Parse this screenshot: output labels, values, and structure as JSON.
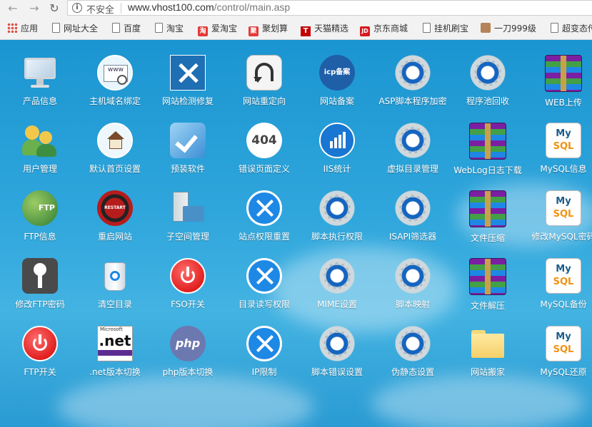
{
  "browser": {
    "address": {
      "insecure_label": "不安全",
      "url_host": "www.vhost100.com",
      "url_path": "/control/main.asp"
    },
    "bookmarks": [
      "应用",
      "网址大全",
      "百度",
      "淘宝",
      "爱淘宝",
      "聚划算",
      "天猫精选",
      "京东商城",
      "挂机刷宝",
      "一刀999级",
      "超变态传"
    ]
  },
  "desktop": {
    "items": [
      {
        "label": "产品信息",
        "icon": "monitor-icon"
      },
      {
        "label": "主机域名绑定",
        "icon": "www-globe-icon"
      },
      {
        "label": "网站检测修复",
        "icon": "tools-icon"
      },
      {
        "label": "网站重定向",
        "icon": "redirect-arrow-icon"
      },
      {
        "label": "网站备案",
        "icon": "icp-badge-icon"
      },
      {
        "label": "ASP脚本程序加密",
        "icon": "gear-icon"
      },
      {
        "label": "程序池回收",
        "icon": "gear-icon"
      },
      {
        "label": "WEB上传",
        "icon": "winrar-icon"
      },
      {
        "label": "用户管理",
        "icon": "users-icon"
      },
      {
        "label": "默认首页设置",
        "icon": "home-icon"
      },
      {
        "label": "预装软件",
        "icon": "checkmark-icon"
      },
      {
        "label": "错误页面定义",
        "icon": "404-icon"
      },
      {
        "label": "IIS统计",
        "icon": "bar-chart-icon"
      },
      {
        "label": "虚拟目录管理",
        "icon": "gear-icon"
      },
      {
        "label": "WebLog日志下载",
        "icon": "winrar-icon"
      },
      {
        "label": "MySQL信息",
        "icon": "mysql-icon"
      },
      {
        "label": "FTP信息",
        "icon": "ftp-globe-icon"
      },
      {
        "label": "重启网站",
        "icon": "restart-icon"
      },
      {
        "label": "子空间管理",
        "icon": "server-folder-icon"
      },
      {
        "label": "站点权限重置",
        "icon": "hammer-icon"
      },
      {
        "label": "脚本执行权限",
        "icon": "gear-icon"
      },
      {
        "label": "ISAPI筛选器",
        "icon": "gear-icon"
      },
      {
        "label": "文件压缩",
        "icon": "winrar-icon"
      },
      {
        "label": "修改MySQL密码",
        "icon": "mysql-icon"
      },
      {
        "label": "修改FTP密码",
        "icon": "key-icon"
      },
      {
        "label": "清空目录",
        "icon": "recycle-bin-icon"
      },
      {
        "label": "FSO开关",
        "icon": "power-icon"
      },
      {
        "label": "目录读写权限",
        "icon": "hammer-icon"
      },
      {
        "label": "MIME设置",
        "icon": "gear-icon"
      },
      {
        "label": "脚本映射",
        "icon": "gear-icon"
      },
      {
        "label": "文件解压",
        "icon": "winrar-icon"
      },
      {
        "label": "MySQL备份",
        "icon": "mysql-icon"
      },
      {
        "label": "FTP开关",
        "icon": "power-icon"
      },
      {
        "label": ".net版本切换",
        "icon": "dotnet-icon"
      },
      {
        "label": "php版本切换",
        "icon": "php-icon"
      },
      {
        "label": "IP限制",
        "icon": "hammer-icon"
      },
      {
        "label": "脚本错误设置",
        "icon": "gear-icon"
      },
      {
        "label": "伪静态设置",
        "icon": "gear-icon"
      },
      {
        "label": "网站搬家",
        "icon": "folder-icon"
      },
      {
        "label": "MySQL还原",
        "icon": "mysql-icon"
      }
    ],
    "icon_texts": {
      "icp": "icp备案",
      "e404": "404",
      "ftp": "FTP",
      "restart": "RESTART",
      "dotnet_small": "Microsoft",
      "dotnet": ".net",
      "php": "php",
      "mysql_a": "My",
      "mysql_b": "SQL",
      "www": "www"
    },
    "colors": {
      "background": "#2a9fd6",
      "label": "#ffffff"
    }
  }
}
